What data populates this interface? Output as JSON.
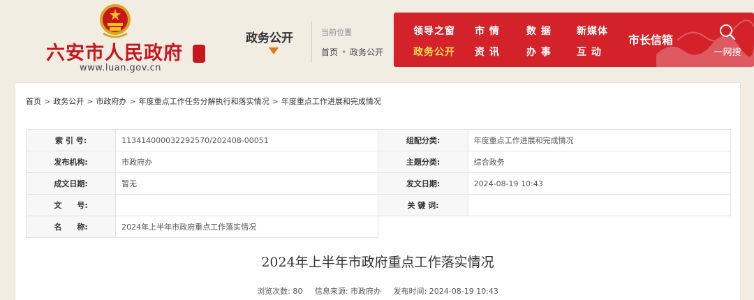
{
  "header": {
    "site_name": "六安市人民政府",
    "site_url": "www.luan.gov.cn",
    "section_title": "政务公开",
    "location_label": "当前位置",
    "location": [
      "首页",
      "政务公开"
    ],
    "nav": [
      {
        "label": "领导之窗",
        "active": false
      },
      {
        "label": "市 情",
        "active": false
      },
      {
        "label": "数 据",
        "active": false
      },
      {
        "label": "新媒体",
        "active": false
      },
      {
        "label": "政务公开",
        "active": true
      },
      {
        "label": "资 讯",
        "active": false
      },
      {
        "label": "办 事",
        "active": false
      },
      {
        "label": "互 动",
        "active": false
      }
    ],
    "mayor_mailbox": "市长信箱",
    "search_label": "一网搜"
  },
  "breadcrumb": [
    "首页",
    "政务公开",
    "市政府办",
    "年度重点工作任务分解执行和落实情况",
    "年度重点工作进展和完成情况"
  ],
  "info": {
    "index_label": "索 引 号:",
    "index_value": "113414000032292570/202408-00051",
    "category_label": "组配分类:",
    "category_value": "年度重点工作进展和完成情况",
    "publisher_label": "发布机构:",
    "publisher_value": "市政府办",
    "topic_label": "主题分类:",
    "topic_value": "综合政务",
    "created_label": "成文日期:",
    "created_value": "暂无",
    "published_label": "发文日期:",
    "published_value": "2024-08-19 10:43",
    "docno_label": "文　　号:",
    "docno_value": "",
    "keywords_label": "关 键 词:",
    "keywords_value": "",
    "name_label": "名　　称:",
    "name_value": "2024年上半年市政府重点工作落实情况"
  },
  "article": {
    "title": "2024年上半年市政府重点工作落实情况",
    "views_label": "浏览次数:",
    "views": "80",
    "source_label": "信息来源:",
    "source": "市政府办",
    "time_label": "发布时间:",
    "time": "2024-08-19 10:43"
  },
  "colors": {
    "brand_red": "#d4222a",
    "active_nav": "#ffe14d",
    "accent_orange": "#e2761a"
  }
}
